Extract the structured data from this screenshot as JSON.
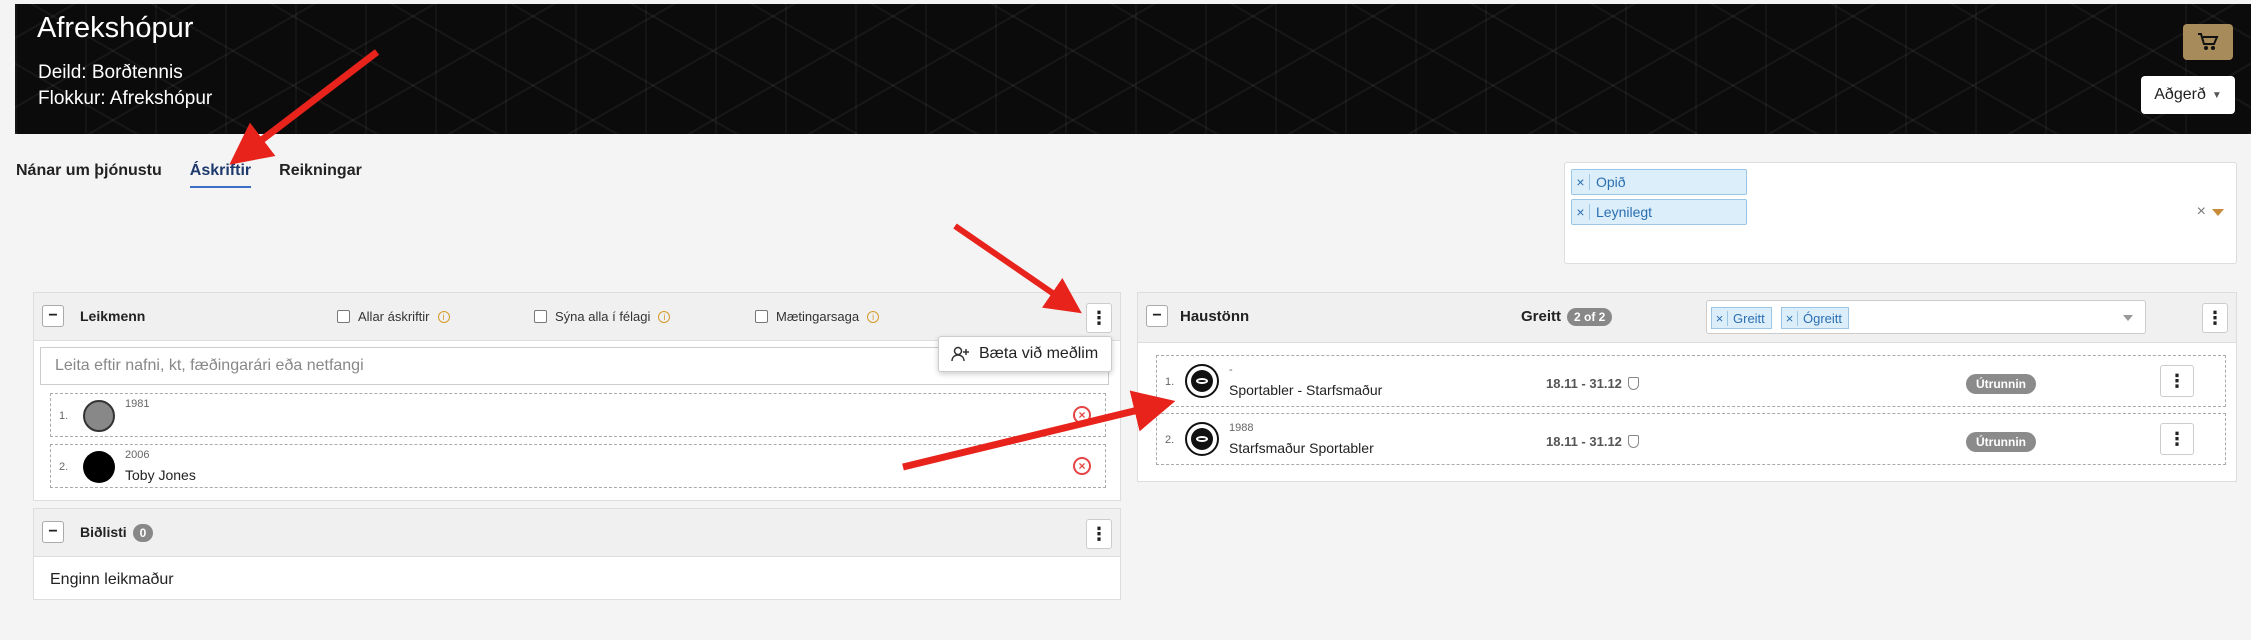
{
  "header": {
    "title": "Afrekshópur",
    "department_label": "Deild: Borðtennis",
    "group_label": "Flokkur: Afrekshópur",
    "action_button": "Aðgerð",
    "cart_icon": "cart-icon"
  },
  "tabs": [
    {
      "label": "Nánar um þjónustu",
      "active": false
    },
    {
      "label": "Áskriftir",
      "active": true
    },
    {
      "label": "Reikningar",
      "active": false
    }
  ],
  "filter": {
    "tags": [
      "Opið",
      "Leynilegt"
    ],
    "clear": "×"
  },
  "players_panel": {
    "title": "Leikmenn",
    "checkboxes": [
      "Allar áskriftir",
      "Sýna alla í félagi",
      "Mætingarsaga"
    ],
    "search_placeholder": "Leita eftir nafni, kt, fæðingarári eða netfangi",
    "menu_item": "Bæta við meðlim",
    "rows": [
      {
        "index": "1.",
        "year": "1981",
        "name": ""
      },
      {
        "index": "2.",
        "year": "2006",
        "name": "Toby Jones"
      }
    ]
  },
  "waitlist_panel": {
    "title": "Biðlisti",
    "count": "0",
    "empty_text": "Enginn leikmaður"
  },
  "term_panel": {
    "title": "Haustönn",
    "paid_label": "Greitt",
    "paid_count": "2 of 2",
    "filter_tags": [
      "Greitt",
      "Ógreitt"
    ],
    "rows": [
      {
        "index": "1.",
        "year": "-",
        "name": "Sportabler - Starfsmaður",
        "dates": "18.11 - 31.12",
        "status": "Útrunnin"
      },
      {
        "index": "2.",
        "year": "1988",
        "name": "Starfsmaður Sportabler",
        "dates": "18.11 - 31.12",
        "status": "Útrunnin"
      }
    ]
  },
  "colors": {
    "accent": "#3b6fc6",
    "cart": "#a88b5a",
    "danger": "#e54545",
    "tag_bg": "#dceefa",
    "arrow": "#e8231c"
  }
}
